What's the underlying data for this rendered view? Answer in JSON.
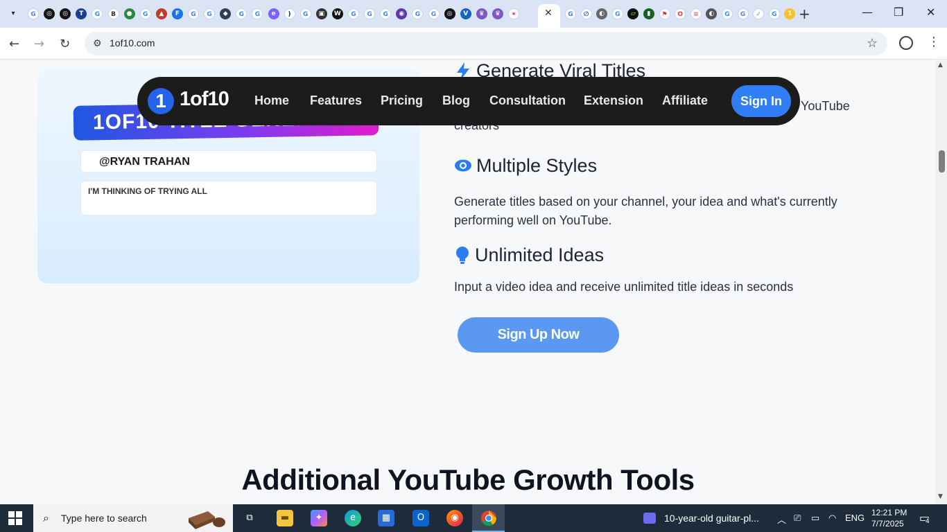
{
  "browser": {
    "url": "1of10.com",
    "tab_close": "✕",
    "new_tab": "+",
    "tab_icons": [
      {
        "bg": "#ffffff",
        "fg": "#4285f4",
        "glyph": "G"
      },
      {
        "bg": "#111111",
        "fg": "#ffffff",
        "glyph": "◎"
      },
      {
        "bg": "#111111",
        "fg": "#ffffff",
        "glyph": "◎"
      },
      {
        "bg": "#1b3f8c",
        "fg": "#ffffff",
        "glyph": "T"
      },
      {
        "bg": "#ffffff",
        "fg": "#4285f4",
        "glyph": "G"
      },
      {
        "bg": "#ffffff",
        "fg": "#333333",
        "glyph": "B"
      },
      {
        "bg": "#2a8c3a",
        "fg": "#ffffff",
        "glyph": "●"
      },
      {
        "bg": "#ffffff",
        "fg": "#4285f4",
        "glyph": "G"
      },
      {
        "bg": "#c0392b",
        "fg": "#ffffff",
        "glyph": "▲"
      },
      {
        "bg": "#1a73e8",
        "fg": "#ffffff",
        "glyph": "F"
      },
      {
        "bg": "#ffffff",
        "fg": "#4285f4",
        "glyph": "G"
      },
      {
        "bg": "#ffffff",
        "fg": "#4285f4",
        "glyph": "G"
      },
      {
        "bg": "#2c3e50",
        "fg": "#ffffff",
        "glyph": "◆"
      },
      {
        "bg": "#ffffff",
        "fg": "#4285f4",
        "glyph": "G"
      },
      {
        "bg": "#ffffff",
        "fg": "#4285f4",
        "glyph": "G"
      },
      {
        "bg": "#7b61ff",
        "fg": "#ffffff",
        "glyph": "e"
      },
      {
        "bg": "#ffffff",
        "fg": "#1a237e",
        "glyph": ")"
      },
      {
        "bg": "#ffffff",
        "fg": "#4285f4",
        "glyph": "G"
      },
      {
        "bg": "#333333",
        "fg": "#ffffff",
        "glyph": "▣"
      },
      {
        "bg": "#111111",
        "fg": "#ffffff",
        "glyph": "W"
      },
      {
        "bg": "#ffffff",
        "fg": "#4285f4",
        "glyph": "G"
      },
      {
        "bg": "#ffffff",
        "fg": "#4285f4",
        "glyph": "G"
      },
      {
        "bg": "#ffffff",
        "fg": "#4285f4",
        "glyph": "G"
      },
      {
        "bg": "#5e35b1",
        "fg": "#ffffff",
        "glyph": "◉"
      },
      {
        "bg": "#ffffff",
        "fg": "#4285f4",
        "glyph": "G"
      },
      {
        "bg": "#ffffff",
        "fg": "#4285f4",
        "glyph": "G"
      },
      {
        "bg": "#111111",
        "fg": "#ffffff",
        "glyph": "◎"
      },
      {
        "bg": "#1565c0",
        "fg": "#ffffff",
        "glyph": "V"
      },
      {
        "bg": "#7e57c2",
        "fg": "#ffffff",
        "glyph": "♛"
      },
      {
        "bg": "#7e57c2",
        "fg": "#ffffff",
        "glyph": "♛"
      },
      {
        "bg": "#ffffff",
        "fg": "#e91e63",
        "glyph": "✶"
      }
    ],
    "tab_icons_right": [
      {
        "bg": "#ffffff",
        "fg": "#4285f4",
        "glyph": "G"
      },
      {
        "bg": "#ffffff",
        "fg": "#3f51b5",
        "glyph": "∅"
      },
      {
        "bg": "#666666",
        "fg": "#ffffff",
        "glyph": "◐"
      },
      {
        "bg": "#ffffff",
        "fg": "#4285f4",
        "glyph": "G"
      },
      {
        "bg": "#111111",
        "fg": "#c6ff00",
        "glyph": "▱"
      },
      {
        "bg": "#1b5e20",
        "fg": "#ffffff",
        "glyph": "▮"
      },
      {
        "bg": "#ffffff",
        "fg": "#d32f2f",
        "glyph": "⚑"
      },
      {
        "bg": "#ffffff",
        "fg": "#e53935",
        "glyph": "O"
      },
      {
        "bg": "#ffffff",
        "fg": "#ff5252",
        "glyph": "≡"
      },
      {
        "bg": "#555555",
        "fg": "#ffffff",
        "glyph": "◐"
      },
      {
        "bg": "#ffffff",
        "fg": "#4285f4",
        "glyph": "G"
      },
      {
        "bg": "#ffffff",
        "fg": "#4285f4",
        "glyph": "G"
      },
      {
        "bg": "#ffffff",
        "fg": "#4caf50",
        "glyph": "✓"
      },
      {
        "bg": "#ffffff",
        "fg": "#4285f4",
        "glyph": "G"
      },
      {
        "bg": "#fbc02d",
        "fg": "#ffffff",
        "glyph": "1"
      }
    ]
  },
  "site_nav": {
    "logo_mark": "1",
    "logo_text": "1of10",
    "links": [
      "Home",
      "Features",
      "Pricing",
      "Blog",
      "Consultation",
      "Extension",
      "Affiliate"
    ],
    "sign_in": "Sign In"
  },
  "hero_card": {
    "banner": "1OF10 TITLE GENERATOR",
    "handle": "@RYAN TRAHAN",
    "idea": "I'M THINKING OF TRYING ALL"
  },
  "features": [
    {
      "title": "Generate Viral Titles",
      "desc_tail": "YouTube",
      "desc_line2": "creators",
      "icon": "bolt-icon"
    },
    {
      "title": "Multiple Styles",
      "desc": "Generate titles based on your channel, your idea and what's currently performing well on YouTube.",
      "icon": "eye-icon"
    },
    {
      "title": "Unlimited Ideas",
      "desc": "Input a video idea and receive unlimited title ideas in seconds",
      "icon": "lightbulb-icon"
    }
  ],
  "cta": "Sign Up Now",
  "section_title": "Additional YouTube Growth Tools",
  "taskbar": {
    "search_placeholder": "Type here to search",
    "media_title": "10-year-old guitar-pl...",
    "lang": "ENG",
    "time": "12:21 PM",
    "date": "7/7/2025",
    "notif_count": "4"
  },
  "colors": {
    "accent": "#2f7ef5",
    "nav_bg": "#1c1c1c",
    "cta": "#5b98f2"
  }
}
